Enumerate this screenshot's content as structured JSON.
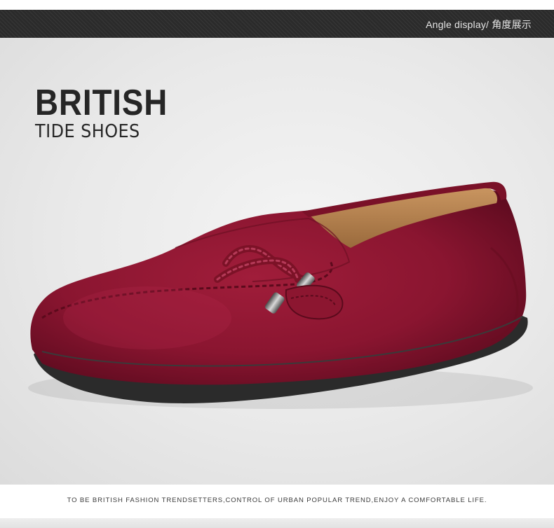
{
  "header": {
    "label": "Angle display/ 角度展示"
  },
  "headline": {
    "title": "BRITISH",
    "subtitle": "TIDE SHOES"
  },
  "product": {
    "color": "#8e1630",
    "description_icon": "loafer-shoe-illustration"
  },
  "footer": {
    "tagline": "TO BE BRITISH FASHION TRENDSETTERS,CONTROL OF URBAN POPULAR TREND,ENJOY A COMFORTABLE LIFE."
  }
}
